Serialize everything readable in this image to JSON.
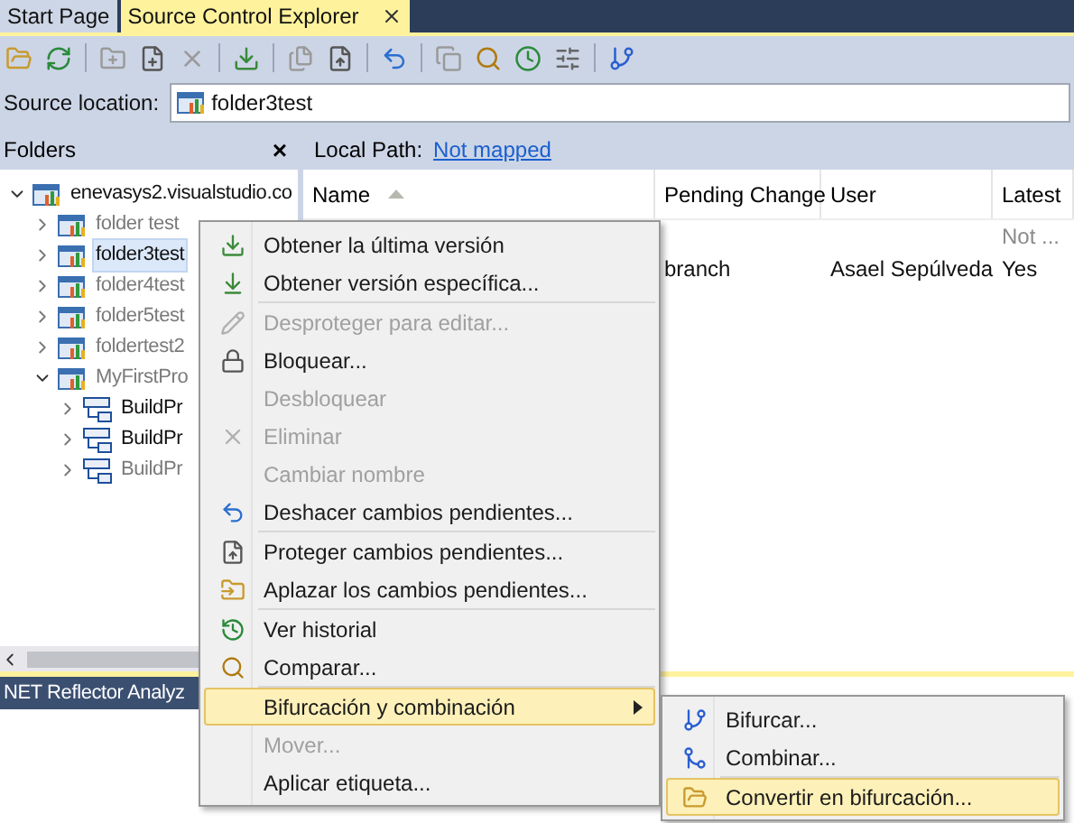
{
  "tabs": [
    {
      "label": "Start Page",
      "selected": false,
      "closable": false
    },
    {
      "label": "Source Control Explorer",
      "selected": true,
      "closable": true
    }
  ],
  "source_location": {
    "label": "Source location:",
    "value": "folder3test"
  },
  "folders": {
    "title": "Folders",
    "close": "×",
    "tree": [
      {
        "label": "enevasys2.visualstudio.co",
        "expanded": true,
        "selected": false,
        "dimmed": false,
        "children": [
          {
            "label": "folder test",
            "expanded": false,
            "selected": false,
            "dimmed": true
          },
          {
            "label": "folder3test",
            "expanded": false,
            "selected": true,
            "dimmed": false
          },
          {
            "label": "folder4test",
            "expanded": false,
            "selected": false,
            "dimmed": true
          },
          {
            "label": "folder5test",
            "expanded": false,
            "selected": false,
            "dimmed": true
          },
          {
            "label": "foldertest2",
            "expanded": false,
            "selected": false,
            "dimmed": true
          },
          {
            "label": "MyFirstPro",
            "expanded": true,
            "selected": false,
            "dimmed": true,
            "children": [
              {
                "label": "BuildPr",
                "expanded": false,
                "selected": false,
                "dimmed": false
              },
              {
                "label": "BuildPr",
                "expanded": false,
                "selected": false,
                "dimmed": false
              },
              {
                "label": "BuildPr",
                "expanded": false,
                "selected": false,
                "dimmed": true
              }
            ]
          }
        ]
      }
    ]
  },
  "details": {
    "local_path_label": "Local Path:",
    "local_path_link": "Not mapped",
    "columns": [
      "Name",
      "Pending Change",
      "User",
      "Latest"
    ],
    "rows": [
      [
        "",
        "",
        "",
        "Not ..."
      ],
      [
        "",
        "branch",
        "Asael Sepúlveda",
        "Yes"
      ]
    ]
  },
  "bottom_panel": {
    "title": "NET Reflector Analyz"
  },
  "context_menu": {
    "groups": [
      [
        {
          "label": "Obtener la última versión",
          "disabled": false,
          "selected": false,
          "submenu": false
        },
        {
          "label": "Obtener versión específica...",
          "disabled": false,
          "selected": false,
          "submenu": false
        }
      ],
      [
        {
          "label": "Desproteger para editar...",
          "disabled": true,
          "selected": false,
          "submenu": false
        },
        {
          "label": "Bloquear...",
          "disabled": false,
          "selected": false,
          "submenu": false
        },
        {
          "label": "Desbloquear",
          "disabled": true,
          "selected": false,
          "submenu": false
        },
        {
          "label": "Eliminar",
          "disabled": true,
          "selected": false,
          "submenu": false
        },
        {
          "label": "Cambiar nombre",
          "disabled": true,
          "selected": false,
          "submenu": false
        },
        {
          "label": "Deshacer cambios pendientes...",
          "disabled": false,
          "selected": false,
          "submenu": false
        }
      ],
      [
        {
          "label": "Proteger cambios pendientes...",
          "disabled": false,
          "selected": false,
          "submenu": false
        },
        {
          "label": "Aplazar los cambios pendientes...",
          "disabled": false,
          "selected": false,
          "submenu": false
        }
      ],
      [
        {
          "label": "Ver historial",
          "disabled": false,
          "selected": false,
          "submenu": false
        },
        {
          "label": "Comparar...",
          "disabled": false,
          "selected": false,
          "submenu": false
        }
      ],
      [
        {
          "label": "Bifurcación y combinación",
          "disabled": false,
          "selected": true,
          "submenu": true
        },
        {
          "label": "Mover...",
          "disabled": true,
          "selected": false,
          "submenu": false
        },
        {
          "label": "Aplicar etiqueta...",
          "disabled": false,
          "selected": false,
          "submenu": false
        }
      ]
    ]
  },
  "submenu": {
    "groups": [
      [
        {
          "label": "Bifurcar...",
          "disabled": false,
          "selected": false
        },
        {
          "label": "Combinar...",
          "disabled": false,
          "selected": false
        }
      ],
      [
        {
          "label": "Convertir en bifurcación...",
          "disabled": false,
          "selected": true
        }
      ]
    ]
  }
}
